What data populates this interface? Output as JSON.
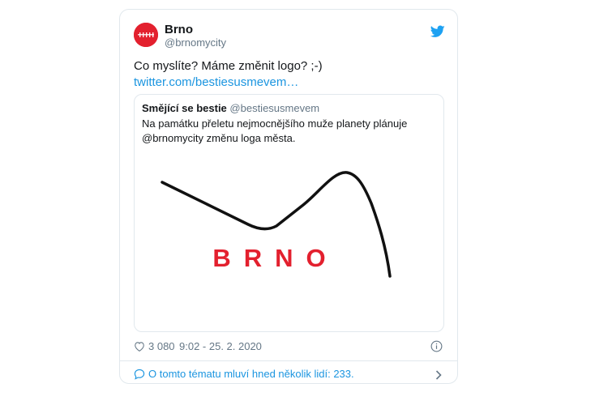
{
  "tweet": {
    "author_name": "Brno",
    "author_handle": "@brnomycity",
    "text": "Co myslíte? Máme změnit logo? ;-)",
    "link": "twitter.com/bestiesusmevem…",
    "quote": {
      "author_name": "Smějící se bestie",
      "author_handle": "@bestiesusmevem",
      "text_line1": "Na památku přeletu nejmocnějšího muže planety plánuje",
      "text_line2": "@brnomycity změnu loga města.",
      "image_logo_text": "BRNO"
    },
    "likes": "3 080",
    "timestamp": "9:02 - 25. 2. 2020",
    "conversation_text": "O tomto tématu mluví hned několik lidí: 233."
  },
  "colors": {
    "brand_red": "#e3202e",
    "link_blue": "#1b95e0",
    "muted": "#657786",
    "border": "#e1e8ed"
  },
  "icons": {
    "verified_bird": "twitter-bird-icon",
    "like": "heart-icon",
    "info": "info-icon",
    "conversation": "speech-bubble-icon",
    "chevron": "chevron-right-icon"
  }
}
